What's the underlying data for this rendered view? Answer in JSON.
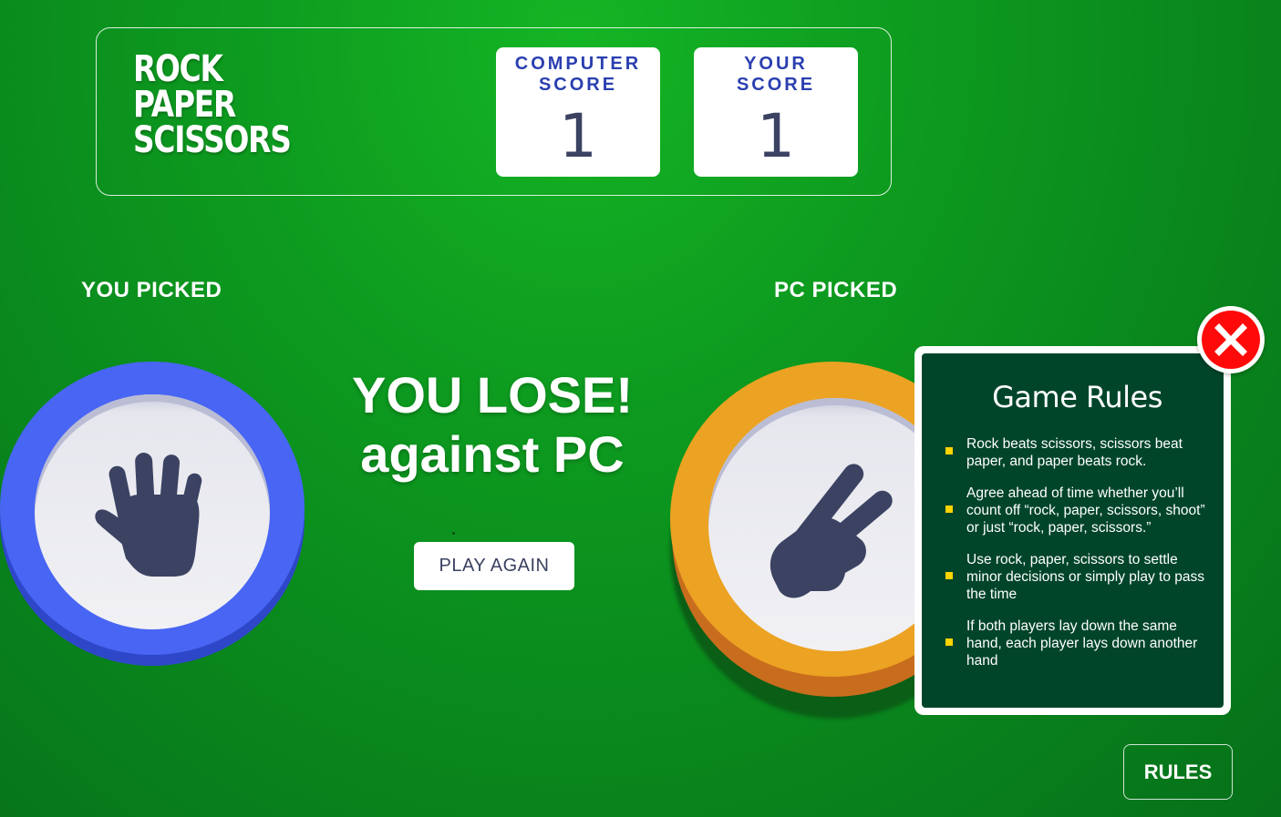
{
  "header": {
    "logo_lines": [
      "ROCK",
      "PAPER",
      "SCISSORS"
    ],
    "computer_score": {
      "label": "COMPUTER SCORE",
      "value": "1"
    },
    "your_score": {
      "label": "YOUR SCORE",
      "value": "1"
    }
  },
  "picks": {
    "you_label": "YOU PICKED",
    "pc_label": "PC PICKED",
    "you_choice": "paper",
    "you_icon": "hand-paper-icon",
    "pc_choice": "scissors",
    "pc_icon": "hand-scissors-icon"
  },
  "result": {
    "title": "YOU LOSE!",
    "subtitle": "against PC",
    "play_again_label": "PLAY AGAIN"
  },
  "rules_modal": {
    "title": "Game Rules",
    "items": [
      "Rock beats scissors, scissors beat paper, and paper beats rock.",
      "Agree ahead of time whether you’ll count off “rock, paper, scissors, shoot” or just “rock, paper, scissors.”",
      "Use rock, paper, scissors to settle minor decisions or simply play to pass the time",
      "If both players lay down the same hand, each player lays down another hand"
    ],
    "close_icon": "close-icon"
  },
  "rules_button_label": "RULES",
  "colors": {
    "background": "#0d9a1f",
    "paper_ring": "#4865f4",
    "scissors_ring": "#eca222",
    "modal_bg": "#00452a",
    "bullet": "#ffd400",
    "close": "#ff0a0a",
    "score_label": "#2a3fb0",
    "hand": "#3b4262"
  }
}
